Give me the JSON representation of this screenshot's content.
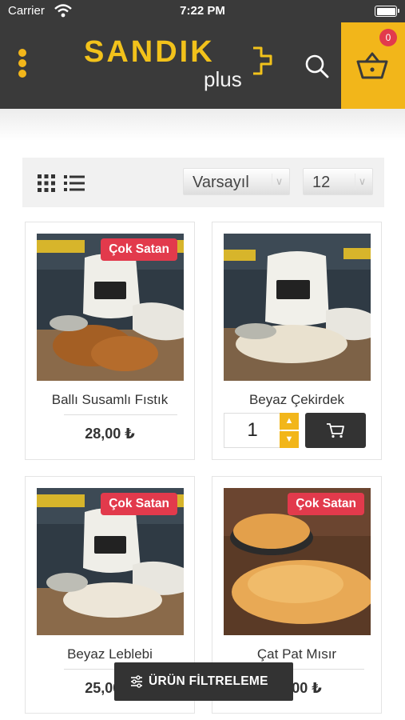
{
  "status_bar": {
    "carrier": "Carrier",
    "time": "7:22 PM"
  },
  "header": {
    "logo_main": "SANDIK",
    "logo_sub": "plus",
    "cart_count": "0",
    "colors": {
      "bar": "#3a3a3a",
      "accent": "#f2b61a",
      "badge": "#e23a4c"
    },
    "icons": [
      "menu-dots-icon",
      "search-icon",
      "cart-icon"
    ]
  },
  "toolbar": {
    "sort_value": "Varsayıl",
    "per_page_value": "12",
    "icons": [
      "grid-view-icon",
      "list-view-icon",
      "chevron-down-icon"
    ]
  },
  "products": [
    {
      "name": "Ballı Susamlı Fıstık",
      "badge": "Çok Satan",
      "price": "28,00 ₺"
    },
    {
      "name": "Beyaz Çekirdek",
      "badge": "",
      "quantity": "1"
    },
    {
      "name": "Beyaz Leblebi",
      "badge": "Çok Satan",
      "price": "25,00 ₺"
    },
    {
      "name": "Çat Pat Mısır",
      "badge": "Çok Satan",
      "price": "25,00 ₺"
    }
  ],
  "filter_button": {
    "label": "ÜRÜN FİLTRELEME",
    "icon": "sliders-icon"
  }
}
